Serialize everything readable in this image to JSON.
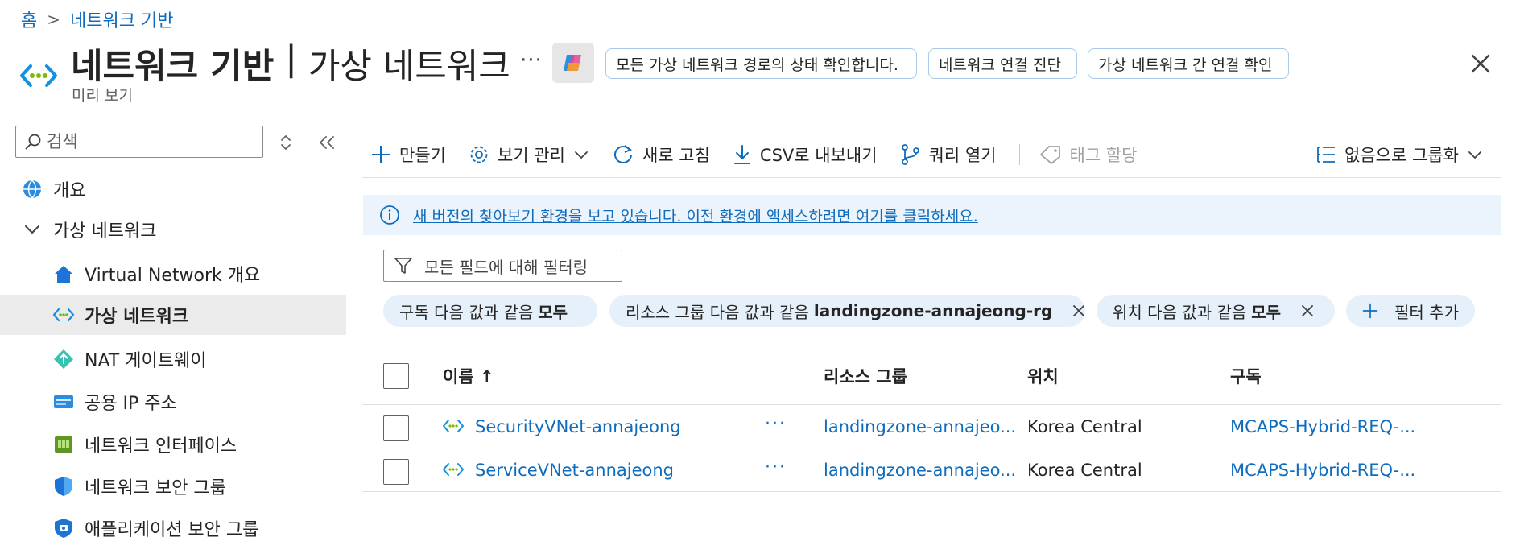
{
  "breadcrumb": {
    "home": "홈",
    "current": "네트워크 기반"
  },
  "header": {
    "title_main": "네트워크 기반",
    "title_sep": "|",
    "title_sub": "가상 네트워크",
    "subtitle": "미리 보기",
    "more": "···",
    "prompts": [
      "모든 가상 네트워크 경로의 상태 확인합니다.",
      "네트워크 연결 진단",
      "가상 네트워크 간 연결 확인"
    ]
  },
  "sidebar": {
    "search_placeholder": "검색",
    "items": [
      {
        "label": "개요",
        "icon": "globe-icon"
      },
      {
        "label": "가상 네트워크",
        "icon": "chevron-down-icon"
      },
      {
        "label": "Virtual Network 개요",
        "icon": "home-icon"
      },
      {
        "label": "가상 네트워크",
        "icon": "vnet-icon"
      },
      {
        "label": "NAT 게이트웨이",
        "icon": "nat-gateway-icon"
      },
      {
        "label": "공용 IP 주소",
        "icon": "public-ip-icon"
      },
      {
        "label": "네트워크 인터페이스",
        "icon": "network-interface-icon"
      },
      {
        "label": "네트워크 보안 그룹",
        "icon": "nsg-shield-icon"
      },
      {
        "label": "애플리케이션 보안 그룹",
        "icon": "asg-icon"
      }
    ]
  },
  "toolbar": {
    "create": "만들기",
    "manage_view": "보기 관리",
    "refresh": "새로 고침",
    "export_csv": "CSV로 내보내기",
    "open_query": "쿼리 열기",
    "assign_tags": "태그 할당",
    "group_by": "없음으로 그룹화"
  },
  "info_bar": {
    "message": "새 버전의 찾아보기 환경을 보고 있습니다. 이전 환경에 액세스하려면 여기를 클릭하세요."
  },
  "filter": {
    "placeholder": "모든 필드에 대해 필터링",
    "pills": [
      {
        "prefix": "구독 다음 값과 같음",
        "value": "모두"
      },
      {
        "prefix": "리소스 그룹 다음 값과 같음",
        "value": "landingzone-annajeong-rg"
      },
      {
        "prefix": "위치 다음 값과 같음",
        "value": "모두"
      }
    ],
    "add_filter": "필터 추가"
  },
  "table": {
    "columns": {
      "name": "이름 ↑",
      "resource_group": "리소스 그룹",
      "location": "위치",
      "subscription": "구독"
    },
    "rows": [
      {
        "name": "SecurityVNet-annajeong",
        "more": "···",
        "resource_group": "landingzone-annajeo...",
        "location": "Korea Central",
        "subscription": "MCAPS-Hybrid-REQ-..."
      },
      {
        "name": "ServiceVNet-annajeong",
        "more": "···",
        "resource_group": "landingzone-annajeo...",
        "location": "Korea Central",
        "subscription": "MCAPS-Hybrid-REQ-..."
      }
    ]
  },
  "colors": {
    "accent": "#0f6cbd",
    "selected_bg": "#ebebeb",
    "info_bg": "#ebf3fc",
    "pill_bg": "#e6f0fa"
  }
}
